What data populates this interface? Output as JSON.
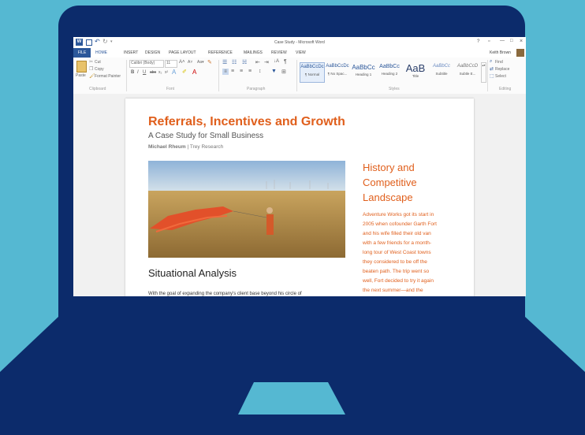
{
  "window": {
    "title": "Case Study - Microsoft Word",
    "controls": [
      "?",
      "▫",
      "—",
      "□",
      "×"
    ],
    "user": "Keith Brown"
  },
  "ribbon": {
    "tabs": [
      "FILE",
      "HOME",
      "INSERT",
      "DESIGN",
      "PAGE LAYOUT",
      "REFERENCE",
      "MAILINGS",
      "REVIEW",
      "VIEW"
    ],
    "clipboard": {
      "paste": "Paste",
      "cut": "Cut",
      "copy": "Copy",
      "format_painter": "Format Painter",
      "group": "Clipboard"
    },
    "font": {
      "name": "Calibri (Body)",
      "size": "11",
      "group": "Font"
    },
    "paragraph": {
      "group": "Paragraph"
    },
    "styles": {
      "group": "Styles",
      "items": [
        {
          "preview": "AaBbCcDc",
          "name": "¶ Normal"
        },
        {
          "preview": "AaBbCcDc",
          "name": "¶ No Spac..."
        },
        {
          "preview": "AaBbCc",
          "name": "Heading 1"
        },
        {
          "preview": "AaBbCc",
          "name": "Heading 2"
        },
        {
          "preview": "AaB",
          "name": "Title"
        },
        {
          "preview": "AaBbCc",
          "name": "Subtitle"
        },
        {
          "preview": "AaBbCcD",
          "name": "Subtle E..."
        }
      ]
    },
    "editing": {
      "find": "Find",
      "replace": "Replace",
      "select": "Select",
      "group": "Editing"
    }
  },
  "document": {
    "title": "Referrals, Incentives and Growth",
    "subtitle": "A Case Study for Small Business",
    "author": "Michael Rheum",
    "company": "Trey Research",
    "section_heading": "Situational Analysis",
    "section_text": "With the goal of expanding the company's client base beyond his circle of",
    "sidebar_heading": [
      "History and",
      "Competitive",
      "Landscape"
    ],
    "sidebar_text": [
      "Adventure Works got its start in",
      "2005 when cofounder Garth Fort",
      "and his wife filled their old van",
      "with a few friends for a month-",
      "long tour of West Coast towns",
      "they considered to be off the",
      "beaten path. The trip went so",
      "well, Fort decided to try it again",
      "the next summer—and the"
    ]
  },
  "colors": {
    "background": "#55b8d2",
    "laptop": "#0c2b6b",
    "accent": "#e05f1c",
    "word_blue": "#2b579a"
  }
}
